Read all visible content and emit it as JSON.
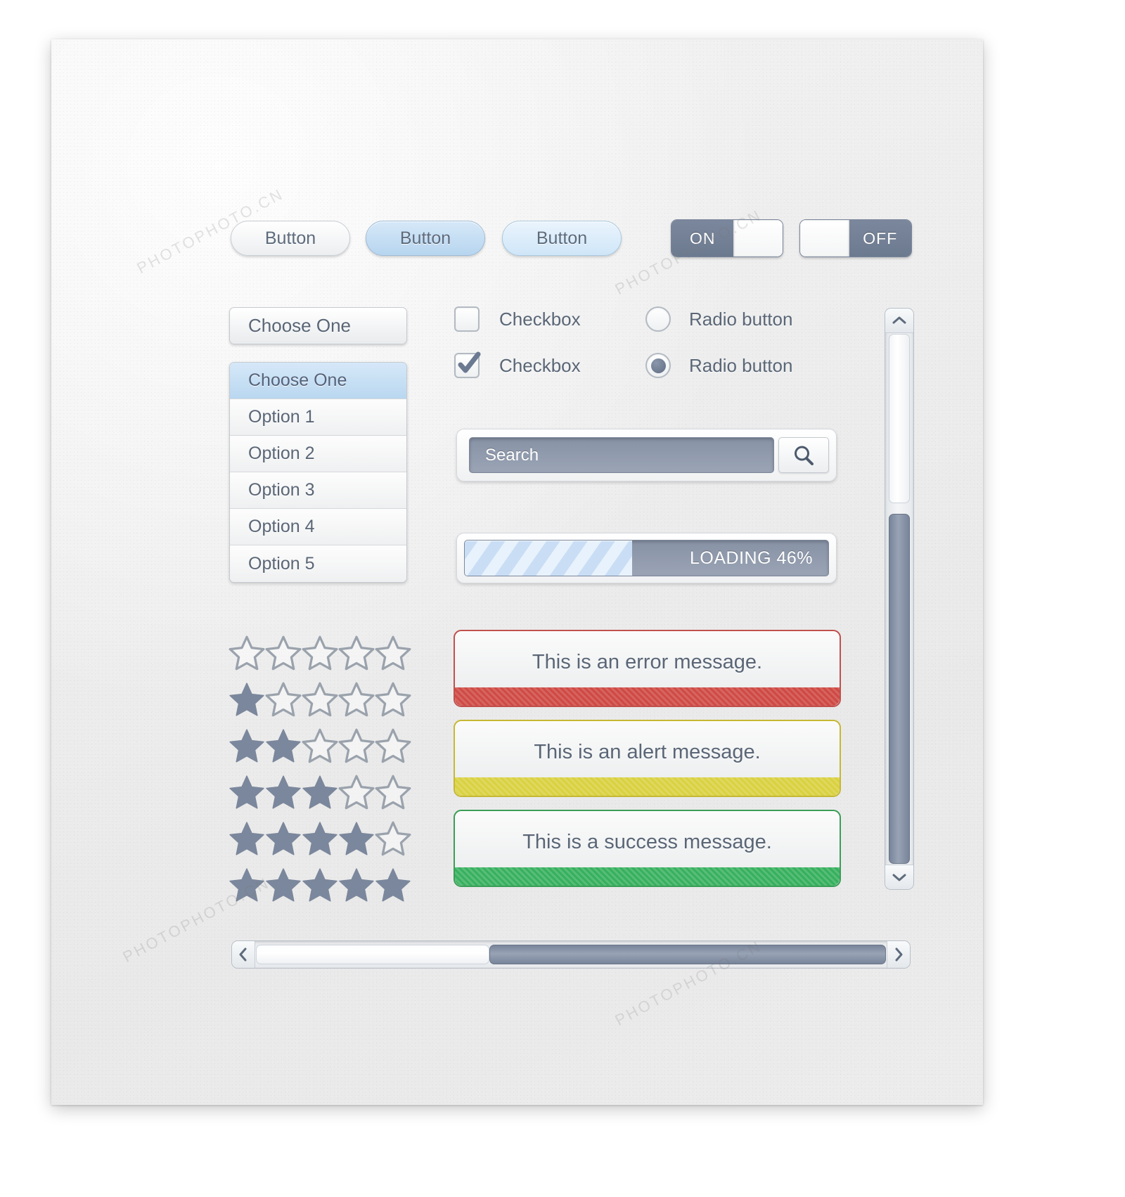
{
  "buttons": [
    {
      "label": "Button",
      "style": "white"
    },
    {
      "label": "Button",
      "style": "blue"
    },
    {
      "label": "Button",
      "style": "light-blue"
    }
  ],
  "toggles": {
    "on": {
      "label": "ON",
      "state": "on"
    },
    "off": {
      "label": "OFF",
      "state": "off"
    }
  },
  "select": {
    "closed_value": "Choose One",
    "options": [
      "Choose One",
      "Option 1",
      "Option 2",
      "Option 3",
      "Option 4",
      "Option 5"
    ],
    "selected_index": 0
  },
  "checkboxes": [
    {
      "label": "Checkbox",
      "checked": false
    },
    {
      "label": "Checkbox",
      "checked": true
    }
  ],
  "radios": [
    {
      "label": "Radio button",
      "checked": false
    },
    {
      "label": "Radio button",
      "checked": true
    }
  ],
  "search": {
    "value": "Search",
    "placeholder": "Search",
    "icon": "search-icon"
  },
  "progress": {
    "label": "LOADING 46%",
    "percent": 46,
    "fill_color": "#cfe3f6",
    "track_color": "#8792a5"
  },
  "rating": {
    "max": 5,
    "rows": [
      0,
      1,
      2,
      3,
      4,
      5
    ],
    "filled_color": "#7b879c",
    "empty_color": "#9aa2ac"
  },
  "messages": [
    {
      "text": "This is an error message.",
      "type": "error",
      "color": "#c0504d"
    },
    {
      "text": "This is an alert message.",
      "type": "alert",
      "color": "#c6b833"
    },
    {
      "text": "This is a success message.",
      "type": "success",
      "color": "#3a9e57"
    }
  ],
  "scrollbars": {
    "vertical": {
      "up_icon": "chevron-up-icon",
      "down_icon": "chevron-down-icon",
      "thumb_percent": 32
    },
    "horizontal": {
      "left_icon": "chevron-left-icon",
      "right_icon": "chevron-right-icon",
      "thumb_percent": 37
    }
  },
  "watermarks": [
    "PHOTOPHOTO.CN",
    "PHOTOPHOTO.CN",
    "PHOTOPHOTO.CN",
    "PHOTOPHOTO.CN"
  ]
}
